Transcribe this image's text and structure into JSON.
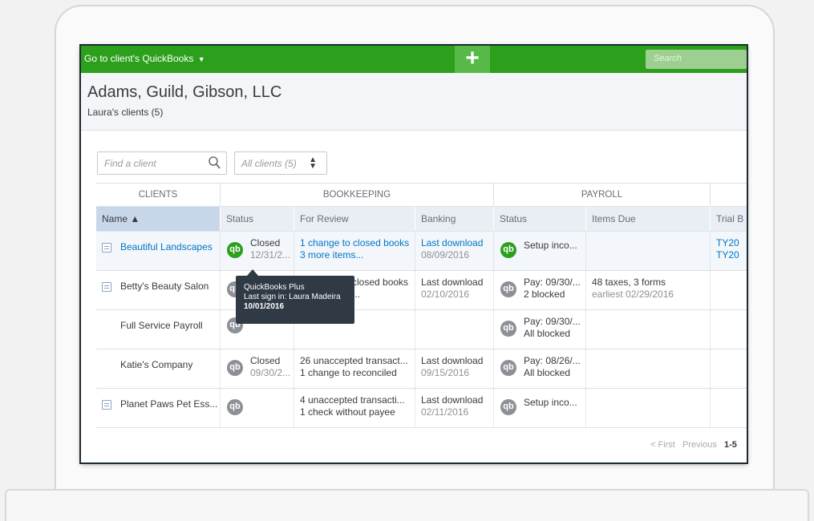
{
  "topbar": {
    "client_switch": "Go to client's QuickBooks",
    "plus": "+",
    "search_placeholder": "Search"
  },
  "header": {
    "company": "Adams, Guild, Gibson, LLC",
    "subtitle": "Laura's clients (5)"
  },
  "filters": {
    "find_placeholder": "Find a client",
    "client_filter": "All clients (5)"
  },
  "table": {
    "groups": [
      "CLIENTS",
      "BOOKKEEPING",
      "PAYROLL",
      ""
    ],
    "columns": [
      "Name ▲",
      "Status",
      "For Review",
      "Banking",
      "Status",
      "Items Due",
      "Trial B"
    ],
    "rows": [
      {
        "name": "Beautiful Landscapes",
        "status1": "Closed",
        "status2": "12/31/2...",
        "review1": "1 change to closed books",
        "review2": "3 more items...",
        "bank1": "Last download",
        "bank2": "08/09/2016",
        "pay1": "Setup inco...",
        "pay2": "",
        "items1": "",
        "items2": "",
        "trial1": "TY20",
        "trial2": "TY20"
      },
      {
        "name": "Betty's Beauty Salon",
        "status1": "",
        "status2": "",
        "review1": "closed books",
        "review2": "...",
        "bank1": "Last download",
        "bank2": "02/10/2016",
        "pay1": "Pay: 09/30/...",
        "pay2": "2 blocked",
        "items1": "48 taxes, 3 forms",
        "items2": "earliest 02/29/2016",
        "trial1": "",
        "trial2": ""
      },
      {
        "name": "Full Service Payroll",
        "status1": "",
        "status2": "",
        "review1": "",
        "review2": "",
        "bank1": "",
        "bank2": "",
        "pay1": "Pay: 09/30/...",
        "pay2": "All blocked",
        "items1": "",
        "items2": "",
        "trial1": "",
        "trial2": ""
      },
      {
        "name": "Katie's Company",
        "status1": "Closed",
        "status2": "09/30/2...",
        "review1": "26 unaccepted transact...",
        "review2": "1 change to reconciled",
        "bank1": "Last download",
        "bank2": "09/15/2016",
        "pay1": "Pay: 08/26/...",
        "pay2": "All blocked",
        "items1": "",
        "items2": "",
        "trial1": "",
        "trial2": ""
      },
      {
        "name": "Planet Paws Pet Ess...",
        "status1": "",
        "status2": "",
        "review1": "4 unaccepted transacti...",
        "review2": "1 check without payee",
        "bank1": "Last download",
        "bank2": "02/11/2016",
        "pay1": "Setup inco...",
        "pay2": "",
        "items1": "",
        "items2": "",
        "trial1": "",
        "trial2": ""
      }
    ]
  },
  "tooltip": {
    "line1": "QuickBooks Plus",
    "line2": "Last sign in: Laura Madeira",
    "line3": "10/01/2016"
  },
  "pager": {
    "first": "< First",
    "previous": "Previous",
    "range": "1-5"
  },
  "qb_glyph": "qb",
  "colors": {
    "brand_green": "#2ca01c",
    "link_blue": "#0077c5",
    "tooltip_bg": "#2f3a45"
  }
}
